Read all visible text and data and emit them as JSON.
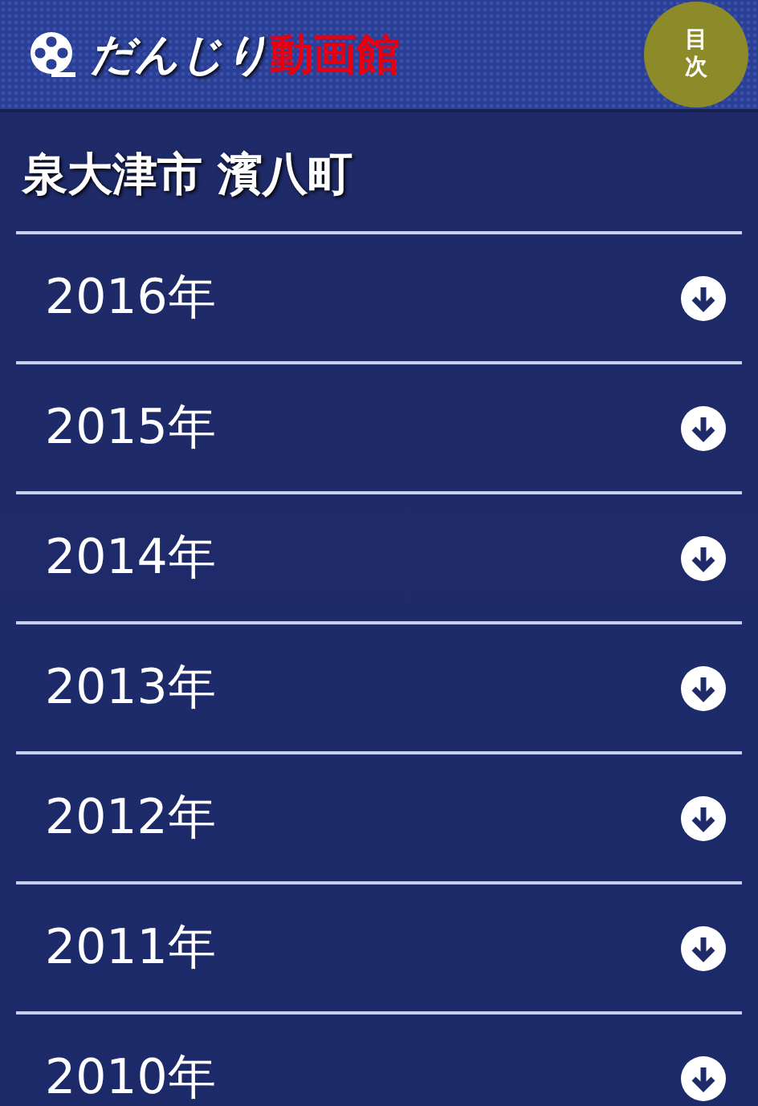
{
  "header": {
    "title": "だんじり",
    "title_accent": "動画館",
    "menu_button": "目次"
  },
  "page_title": "泉大津市 濱八町",
  "years": [
    {
      "label": "2016年"
    },
    {
      "label": "2015年"
    },
    {
      "label": "2014年"
    },
    {
      "label": "2013年"
    },
    {
      "label": "2012年"
    },
    {
      "label": "2011年"
    },
    {
      "label": "2010年"
    }
  ]
}
